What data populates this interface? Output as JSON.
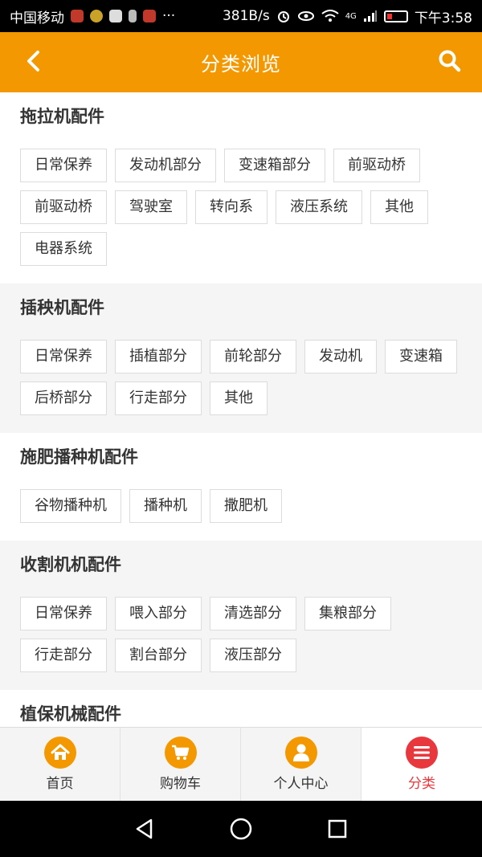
{
  "status_bar": {
    "carrier": "中国移动",
    "speed": "381B/s",
    "network": "4G",
    "time": "下午3:58"
  },
  "header": {
    "title": "分类浏览",
    "back_icon": "chevron-left-icon",
    "search_icon": "search-icon",
    "color": "#f39800"
  },
  "categories": [
    {
      "title": "拖拉机配件",
      "items": [
        "日常保养",
        "发动机部分",
        "变速箱部分",
        "前驱动桥",
        "前驱动桥",
        "驾驶室",
        "转向系",
        "液压系统",
        "其他",
        "电器系统"
      ]
    },
    {
      "title": "插秧机配件",
      "items": [
        "日常保养",
        "插植部分",
        "前轮部分",
        "发动机",
        "变速箱",
        "后桥部分",
        "行走部分",
        "其他"
      ]
    },
    {
      "title": "施肥播种机配件",
      "items": [
        "谷物播种机",
        "播种机",
        "撒肥机"
      ]
    },
    {
      "title": "收割机机配件",
      "items": [
        "日常保养",
        "喂入部分",
        "清选部分",
        "集粮部分",
        "行走部分",
        "割台部分",
        "液压部分"
      ]
    },
    {
      "title": "植保机械配件",
      "items": []
    }
  ],
  "tabbar": [
    {
      "label": "首页",
      "icon": "home-icon",
      "active": false
    },
    {
      "label": "购物车",
      "icon": "cart-icon",
      "active": false
    },
    {
      "label": "个人中心",
      "icon": "user-icon",
      "active": false
    },
    {
      "label": "分类",
      "icon": "menu-icon",
      "active": true
    }
  ],
  "colors": {
    "accent": "#f39800",
    "active": "#e8383d"
  }
}
